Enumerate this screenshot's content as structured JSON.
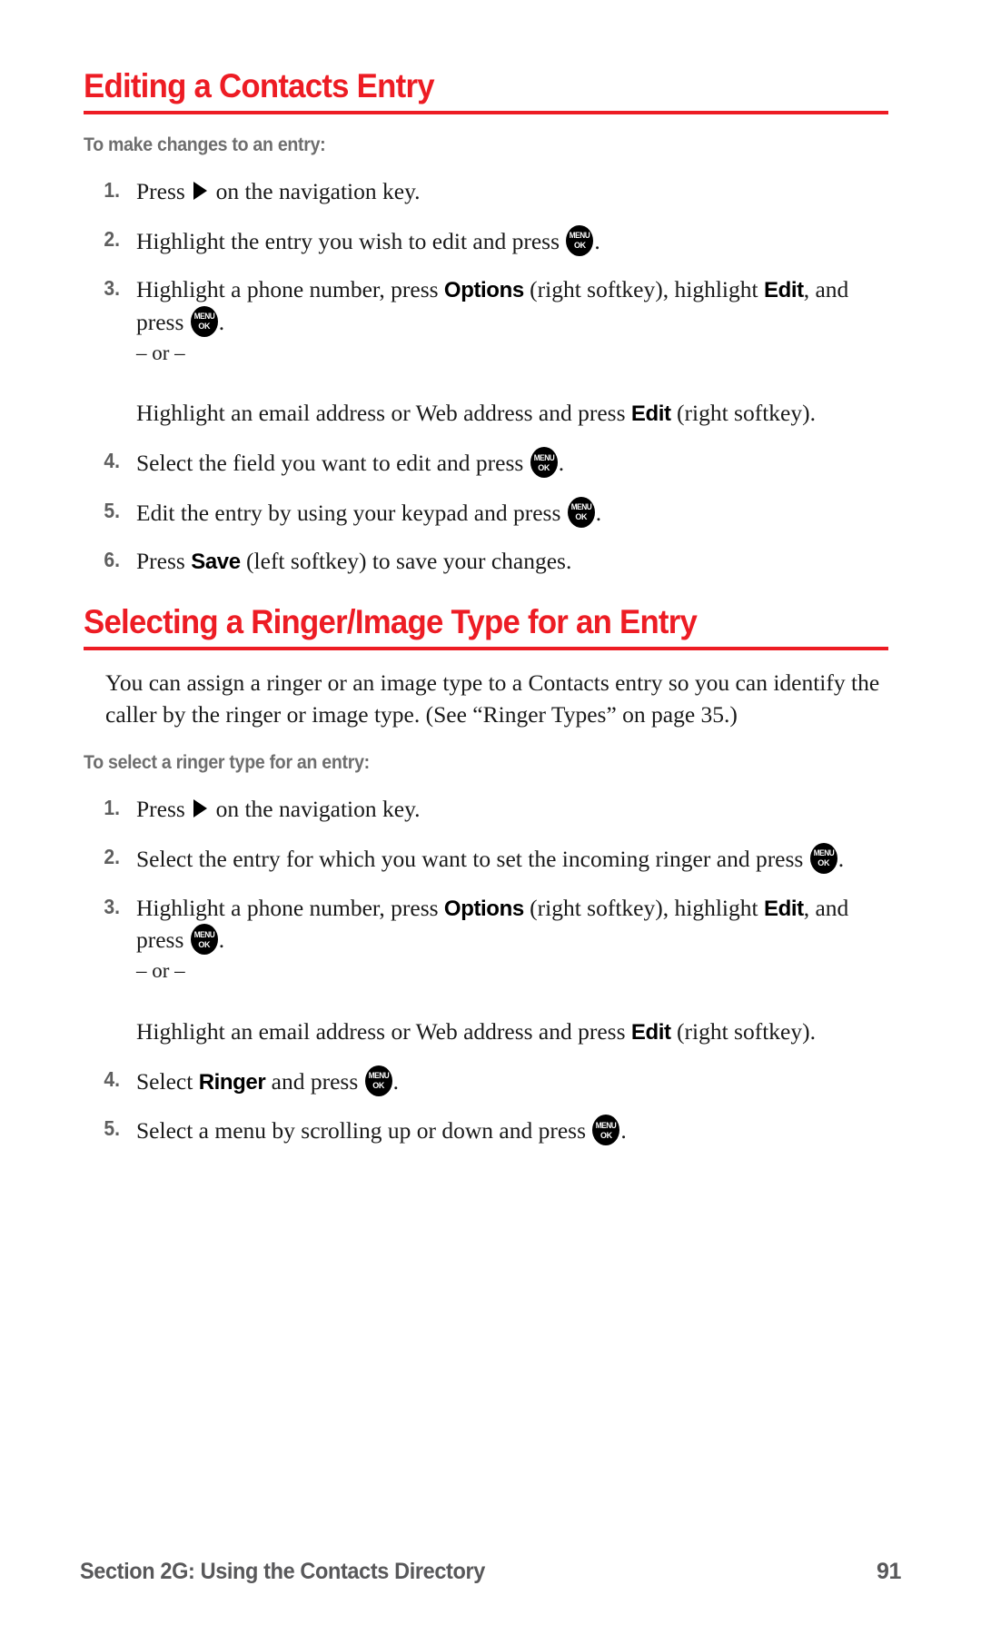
{
  "page": {
    "number": "91",
    "footer_section": "Section 2G: Using the Contacts Directory",
    "accent_color": "#ed1c24",
    "subheading_color": "#6e6e6e",
    "footer_color": "#58585a"
  },
  "icons": {
    "menu_ok_top": "MENU",
    "menu_ok_bottom": "OK",
    "nav_right": "navigation-right-arrow"
  },
  "sections": [
    {
      "heading": "Editing a Contacts Entry",
      "subheading": "To make changes to an entry:",
      "steps": [
        {
          "num": "1.",
          "parts": [
            {
              "t": "text",
              "v": "Press "
            },
            {
              "t": "nav-arrow"
            },
            {
              "t": "text",
              "v": " on the navigation key."
            }
          ]
        },
        {
          "num": "2.",
          "parts": [
            {
              "t": "text",
              "v": "Highlight the entry you wish to edit and press "
            },
            {
              "t": "menu-ok"
            },
            {
              "t": "text",
              "v": "."
            }
          ]
        },
        {
          "num": "3.",
          "parts": [
            {
              "t": "text",
              "v": "Highlight a phone number, press "
            },
            {
              "t": "ui",
              "v": "Options"
            },
            {
              "t": "text",
              "v": " (right softkey), highlight "
            },
            {
              "t": "ui",
              "v": "Edit"
            },
            {
              "t": "text",
              "v": ", and press "
            },
            {
              "t": "menu-ok"
            },
            {
              "t": "text",
              "v": "."
            },
            {
              "t": "break"
            },
            {
              "t": "or",
              "v": "– or –"
            },
            {
              "t": "break"
            },
            {
              "t": "text",
              "v": "Highlight an email address or Web address and press "
            },
            {
              "t": "ui",
              "v": "Edit"
            },
            {
              "t": "text",
              "v": " (right softkey)."
            }
          ]
        },
        {
          "num": "4.",
          "parts": [
            {
              "t": "text",
              "v": "Select the field you want to edit and press "
            },
            {
              "t": "menu-ok"
            },
            {
              "t": "text",
              "v": "."
            }
          ]
        },
        {
          "num": "5.",
          "parts": [
            {
              "t": "text",
              "v": "Edit the entry by using your keypad and press "
            },
            {
              "t": "menu-ok"
            },
            {
              "t": "text",
              "v": "."
            }
          ]
        },
        {
          "num": "6.",
          "parts": [
            {
              "t": "text",
              "v": "Press "
            },
            {
              "t": "ui",
              "v": "Save"
            },
            {
              "t": "text",
              "v": " (left softkey) to save your changes."
            }
          ]
        }
      ]
    },
    {
      "heading": "Selecting a Ringer/Image Type for an Entry",
      "body": "You can assign a ringer or an image type to a Contacts entry so you can identify the caller by the ringer or image type. (See “Ringer Types” on page 35.)",
      "subheading": "To select a ringer type for an entry:",
      "steps": [
        {
          "num": "1.",
          "parts": [
            {
              "t": "text",
              "v": "Press "
            },
            {
              "t": "nav-arrow"
            },
            {
              "t": "text",
              "v": " on the navigation key."
            }
          ]
        },
        {
          "num": "2.",
          "parts": [
            {
              "t": "text",
              "v": "Select the entry for which you want to set the incoming ringer and press "
            },
            {
              "t": "menu-ok"
            },
            {
              "t": "text",
              "v": "."
            }
          ]
        },
        {
          "num": "3.",
          "parts": [
            {
              "t": "text",
              "v": "Highlight a phone number, press "
            },
            {
              "t": "ui",
              "v": "Options"
            },
            {
              "t": "text",
              "v": " (right softkey), highlight "
            },
            {
              "t": "ui",
              "v": "Edit"
            },
            {
              "t": "text",
              "v": ", and press "
            },
            {
              "t": "menu-ok"
            },
            {
              "t": "text",
              "v": "."
            },
            {
              "t": "break"
            },
            {
              "t": "or",
              "v": "– or –"
            },
            {
              "t": "break"
            },
            {
              "t": "text",
              "v": "Highlight an email address or Web address and press "
            },
            {
              "t": "ui",
              "v": "Edit"
            },
            {
              "t": "text",
              "v": " (right softkey)."
            }
          ]
        },
        {
          "num": "4.",
          "parts": [
            {
              "t": "text",
              "v": "Select "
            },
            {
              "t": "ui",
              "v": "Ringer"
            },
            {
              "t": "text",
              "v": " and press "
            },
            {
              "t": "menu-ok"
            },
            {
              "t": "text",
              "v": "."
            }
          ]
        },
        {
          "num": "5.",
          "parts": [
            {
              "t": "text",
              "v": "Select a menu by scrolling up or down and press "
            },
            {
              "t": "menu-ok"
            },
            {
              "t": "text",
              "v": "."
            }
          ]
        }
      ]
    }
  ]
}
